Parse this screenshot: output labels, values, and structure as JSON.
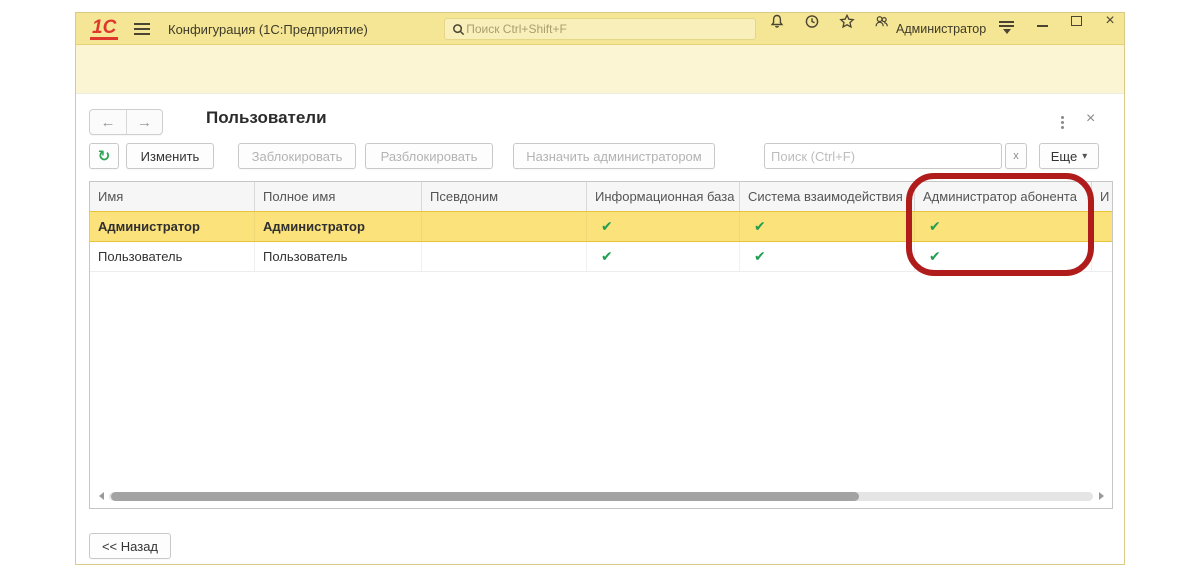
{
  "titlebar": {
    "logo": "1С",
    "app_title": "Конфигурация  (1С:Предприятие)",
    "search_placeholder": "Поиск Ctrl+Shift+F",
    "user_name": "Администратор"
  },
  "form": {
    "title": "Пользователи",
    "toolbar": {
      "edit_label": "Изменить",
      "lock_label": "Заблокировать",
      "unlock_label": "Разблокировать",
      "assign_admin_label": "Назначить администратором",
      "search_placeholder": "Поиск (Ctrl+F)",
      "clear_label": "x",
      "more_label": "Еще"
    },
    "back_label": "<< Назад"
  },
  "table": {
    "columns": [
      "Имя",
      "Полное имя",
      "Псевдоним",
      "Информационная база",
      "Система взаимодействия",
      "Администратор абонента",
      "И"
    ],
    "rows": [
      {
        "name": "Администратор",
        "full_name": "Администратор",
        "alias": "",
        "infobase": true,
        "interaction_system": true,
        "tenant_admin": true,
        "selected": true
      },
      {
        "name": "Пользователь",
        "full_name": "Пользователь",
        "alias": "",
        "infobase": true,
        "interaction_system": true,
        "tenant_admin": true,
        "selected": false
      }
    ]
  },
  "icons": {
    "check": "✔",
    "back_arrow": "←",
    "forward_arrow": "→",
    "refresh": "↻",
    "more_arrow": "▾",
    "close": "×",
    "clear": "×",
    "kebab": "⋮"
  },
  "colors": {
    "titlebar_yellow": "#f5e695",
    "panel_cream": "#fcf5d4",
    "selected_row_yellow": "#fbe27b",
    "selected_row_border": "#e7c33a",
    "check_green": "#1e9e50",
    "annotation_red": "#b01c1c",
    "logo_red": "#e0372c"
  },
  "annotation": {
    "highlighted_column": "Администратор абонента"
  }
}
